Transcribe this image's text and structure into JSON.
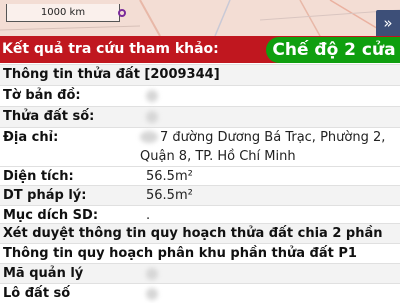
{
  "map": {
    "scale_label": "1000 km",
    "blurred_text": "",
    "expand_icon": "double-chevron-right",
    "expand_label": "»"
  },
  "header": {
    "title": "Kết quả tra cứu tham khảo:",
    "mode_button": "Chế độ 2 cửa",
    "bg_color": "#c0171f",
    "button_color": "#0f9f0f"
  },
  "parcel": {
    "section_title": "Thông tin thửa đất [2009344]",
    "rows": [
      {
        "label": "Tờ bản đồ:",
        "value": ""
      },
      {
        "label": "Thửa đất số:",
        "value": ""
      },
      {
        "label": "Địa chỉ:",
        "value_line1": "7 đường Dương Bá Trạc, Phường 2,",
        "value_line2": "Quận 8, TP. Hồ Chí Minh"
      },
      {
        "label": "Diện tích:",
        "value": "56.5m²"
      },
      {
        "label": "DT pháp lý:",
        "value": "56.5m²"
      },
      {
        "label": "Mục dích SD:",
        "value": "."
      }
    ],
    "planning_approval": "Xét duyệt thông tin quy hoạch thửa đất chia 2 phần",
    "zone_planning": "Thông tin quy hoạch phân khu phần thửa đất P1",
    "management_code_label": "Mã quản lý",
    "lot_label": "Lô đất số"
  }
}
